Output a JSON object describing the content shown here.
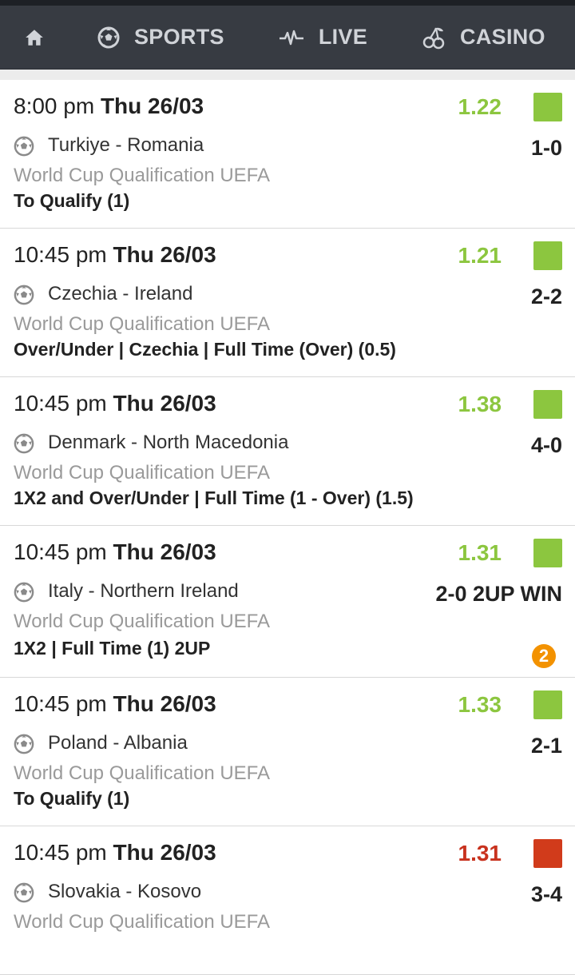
{
  "nav": {
    "home_icon": "home-icon",
    "sports_label": "SPORTS",
    "live_label": "LIVE",
    "casino_label": "CASINO"
  },
  "colors": {
    "won": "#8cc63f",
    "lost": "#d13b1b",
    "navbar": "#373b42",
    "badge": "#f39200"
  },
  "bets": [
    {
      "time": "8:00 pm",
      "date": "Thu 26/03",
      "odds": "1.22",
      "status": "won",
      "match": "Turkiye - Romania",
      "score": "1-0",
      "league": "World Cup Qualification UEFA",
      "market": "To Qualify (1)"
    },
    {
      "time": "10:45 pm",
      "date": "Thu 26/03",
      "odds": "1.21",
      "status": "won",
      "match": "Czechia - Ireland",
      "score": "2-2",
      "league": "World Cup Qualification UEFA",
      "market": "Over/Under | Czechia | Full Time (Over) (0.5)"
    },
    {
      "time": "10:45 pm",
      "date": "Thu 26/03",
      "odds": "1.38",
      "status": "won",
      "match": "Denmark - North Macedonia",
      "score": "4-0",
      "league": "World Cup Qualification UEFA",
      "market": "1X2 and Over/Under | Full Time (1 - Over) (1.5)"
    },
    {
      "time": "10:45 pm",
      "date": "Thu 26/03",
      "odds": "1.31",
      "status": "won",
      "match": "Italy - Northern Ireland",
      "score": "2-0 2UP WIN",
      "league": "World Cup Qualification UEFA",
      "market": "1X2 | Full Time (1)",
      "market_suffix": "2UP",
      "badge": "2"
    },
    {
      "time": "10:45 pm",
      "date": "Thu 26/03",
      "odds": "1.33",
      "status": "won",
      "match": "Poland - Albania",
      "score": "2-1",
      "league": "World Cup Qualification UEFA",
      "market": "To Qualify (1)"
    },
    {
      "time": "10:45 pm",
      "date": "Thu 26/03",
      "odds": "1.31",
      "status": "lost",
      "match": "Slovakia - Kosovo",
      "score": "3-4",
      "league": "World Cup Qualification UEFA",
      "market": ""
    }
  ]
}
